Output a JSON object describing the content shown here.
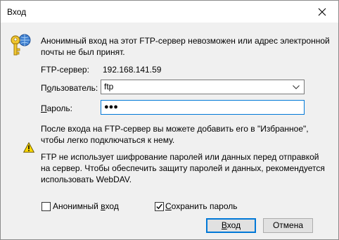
{
  "window": {
    "title": "Вход",
    "close_glyph": "✕"
  },
  "info": {
    "message": "Анонимный вход на этот FTP-сервер невозможен или адрес электронной почты не был принят."
  },
  "server": {
    "label": "FTP-сервер:",
    "value": "192.168.141.59"
  },
  "user": {
    "label_prefix": "П",
    "label_accel": "о",
    "label_suffix": "льзователь:",
    "value": "ftp"
  },
  "password": {
    "label_accel": "П",
    "label_suffix": "ароль:",
    "masked_value": "●●●"
  },
  "favorites_note": "После входа на FTP-сервер вы можете добавить его в \"Избранное\", чтобы легко подключаться к нему.",
  "warning": {
    "text": "FTP не использует шифрование паролей или данных перед отправкой на сервер. Чтобы обеспечить защиту паролей и данных, рекомендуется использовать WebDAV."
  },
  "options": {
    "anonymous_prefix": "Анонимный ",
    "anonymous_accel": "в",
    "anonymous_suffix": "ход",
    "anonymous_checked": false,
    "save_accel": "С",
    "save_suffix": "охранить пароль",
    "save_checked": true
  },
  "buttons": {
    "login_accel": "В",
    "login_suffix": "ход",
    "cancel": "Отмена"
  },
  "colors": {
    "focus_blue": "#0078d7",
    "dialog_bg": "#f0f0f0",
    "warning_yellow": "#ffd800"
  },
  "icons": {
    "info": "key-icon",
    "warning": "warning-triangle-icon",
    "close": "close-icon",
    "dropdown": "chevron-down-icon"
  }
}
